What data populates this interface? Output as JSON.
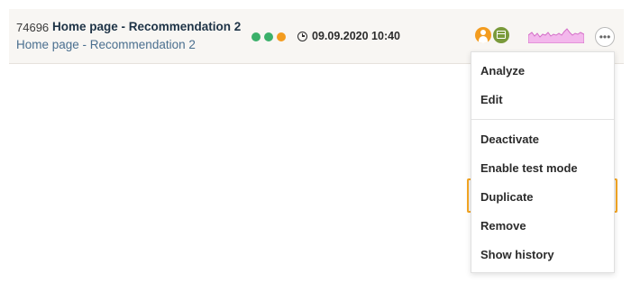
{
  "row": {
    "id": "74696",
    "title": "Home page - Recommendation 2",
    "subtitle": "Home page - Recommendation 2",
    "status_colors": [
      "#3bb06a",
      "#3bb06a",
      "#f39c1f"
    ],
    "date": "09.09.2020 10:40",
    "icons": {
      "clock": "clock-icon",
      "audience": "person-icon",
      "placement": "screen-icon",
      "more": "more-options-icon"
    },
    "sparkline_color": "#d46fc8",
    "more_label": "•••"
  },
  "menu": {
    "items": [
      {
        "label": "Analyze"
      },
      {
        "label": "Edit"
      },
      {
        "label": "Deactivate"
      },
      {
        "label": "Enable test mode"
      },
      {
        "label": "Duplicate",
        "highlighted": true
      },
      {
        "label": "Remove"
      },
      {
        "label": "Show history"
      }
    ],
    "highlight_color": "#f5a623"
  }
}
